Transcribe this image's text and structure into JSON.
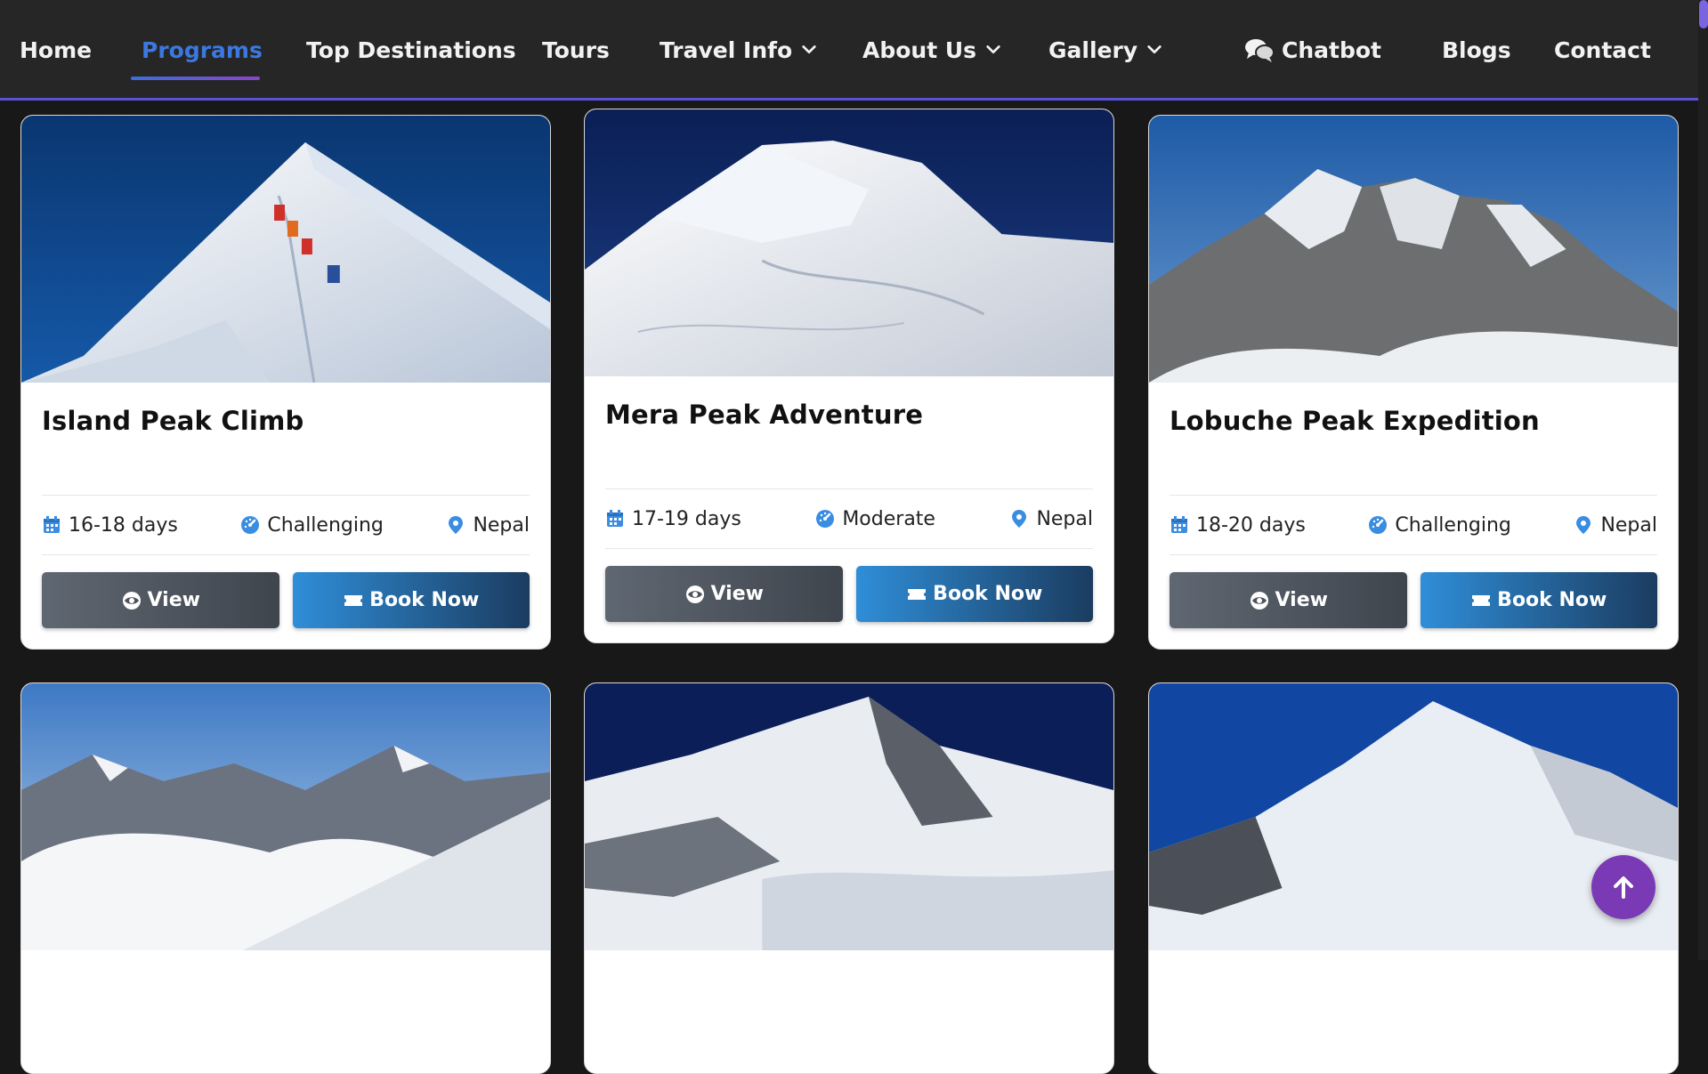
{
  "nav": {
    "items": [
      {
        "label": "Home"
      },
      {
        "label": "Programs"
      },
      {
        "label": "Top Destinations"
      },
      {
        "label": "Tours"
      },
      {
        "label": "Travel Info"
      },
      {
        "label": "About Us"
      },
      {
        "label": "Gallery"
      },
      {
        "label": "Chatbot"
      },
      {
        "label": "Blogs"
      },
      {
        "label": "Contact"
      }
    ],
    "active": "Programs",
    "accent": "#3b78e0"
  },
  "cards": [
    {
      "title": "Island Peak Climb",
      "duration": "16-18 days",
      "difficulty": "Challenging",
      "location": "Nepal",
      "view_label": "View",
      "book_label": "Book Now"
    },
    {
      "title": "Mera Peak Adventure",
      "duration": "17-19 days",
      "difficulty": "Moderate",
      "location": "Nepal",
      "view_label": "View",
      "book_label": "Book Now"
    },
    {
      "title": "Lobuche Peak Expedition",
      "duration": "18-20 days",
      "difficulty": "Challenging",
      "location": "Nepal",
      "view_label": "View",
      "book_label": "Book Now"
    }
  ],
  "icons": {
    "duration": "calendar-icon",
    "difficulty": "gauge-icon",
    "location": "map-pin-icon",
    "view": "eye-icon",
    "book": "ticket-icon",
    "chatbot": "chat-bubbles-icon",
    "scroll_top": "arrow-up-icon"
  },
  "colors": {
    "icon_blue": "#3a8de0",
    "view_button": "#5f6772",
    "book_button": "#2f8ed8",
    "scroll_top_button": "#7a3ab5"
  }
}
